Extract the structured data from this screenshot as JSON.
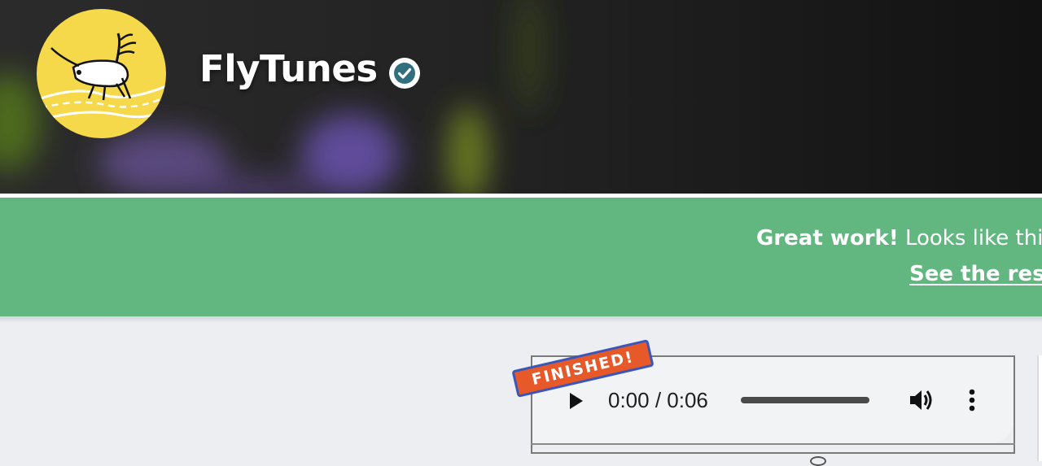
{
  "header": {
    "project_name": "FlyTunes",
    "logo_icon": "cricket-logo-icon",
    "verified_icon": "verified-check-icon"
  },
  "banner": {
    "bold_text": "Great work!",
    "message": " Looks like this",
    "link_text": "See the resu",
    "background_color": "#62b780"
  },
  "audio_player": {
    "stamp_label": "FINISHED!",
    "time_display": "0:00 / 0:06",
    "progress": 0,
    "play_icon": "play-icon",
    "volume_icon": "volume-icon",
    "more_icon": "more-options-icon"
  }
}
